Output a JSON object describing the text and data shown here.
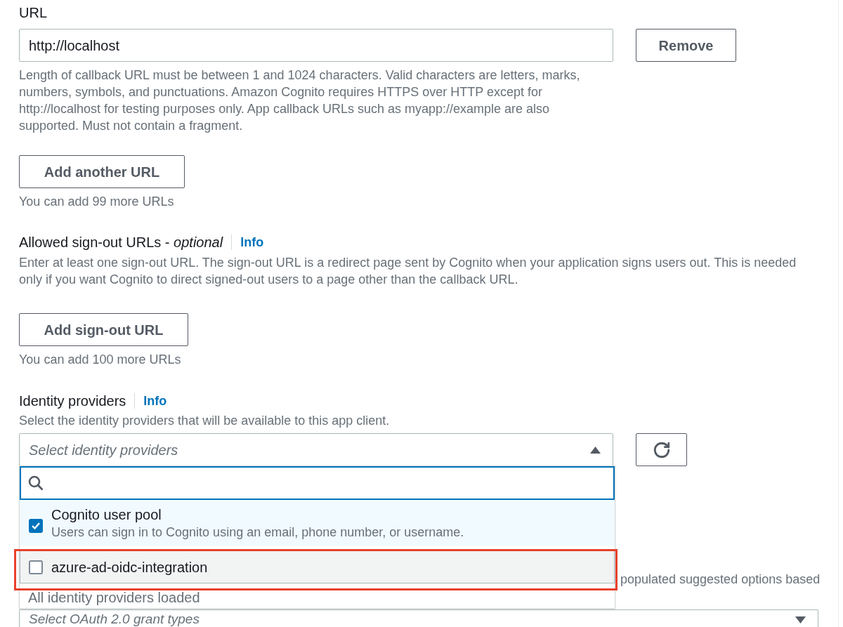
{
  "callback_urls": {
    "label": "URL",
    "url_field": {
      "value": "http://localhost"
    },
    "remove_button": "Remove",
    "description": "Length of callback URL must be between 1 and 1024 characters. Valid characters are letters, marks, numbers, symbols, and punctuations. Amazon Cognito requires HTTPS over HTTP except for http://localhost for testing purposes only. App callback URLs such as myapp://example are also supported. Must not contain a fragment.",
    "add_button": "Add another URL",
    "remaining": "You can add 99 more URLs"
  },
  "sign_out_urls": {
    "label": "Allowed sign-out URLs - *optional*",
    "info_link": "Info",
    "description": "Enter at least one sign-out URL. The sign-out URL is a redirect page sent by Cognito when your application signs users out. This is needed only if you want Cognito to direct signed-out users to a page other than the callback URL.",
    "add_button": "Add sign-out URL",
    "remaining": "You can add 100 more URLs"
  },
  "identity_providers": {
    "label": "Identity providers",
    "info_link": "Info",
    "description": "Select the identity providers that will be available to this app client.",
    "select": {
      "placeholder": "Select identity providers",
      "expanded": true
    },
    "options": [
      {
        "label": "Cognito user pool",
        "description": "Users can sign in to Cognito using an email, phone number, or username.",
        "checked": true,
        "hovered": false,
        "highlighted": false
      },
      {
        "label": "azure-ad-oidc-integration",
        "checked": false,
        "hovered": true,
        "highlighted": true
      }
    ],
    "status": "All identity providers loaded"
  },
  "grant_types": {
    "description": "populated suggested options based",
    "select": {
      "placeholder": "Select OAuth 2.0 grant types",
      "expanded": false
    }
  }
}
